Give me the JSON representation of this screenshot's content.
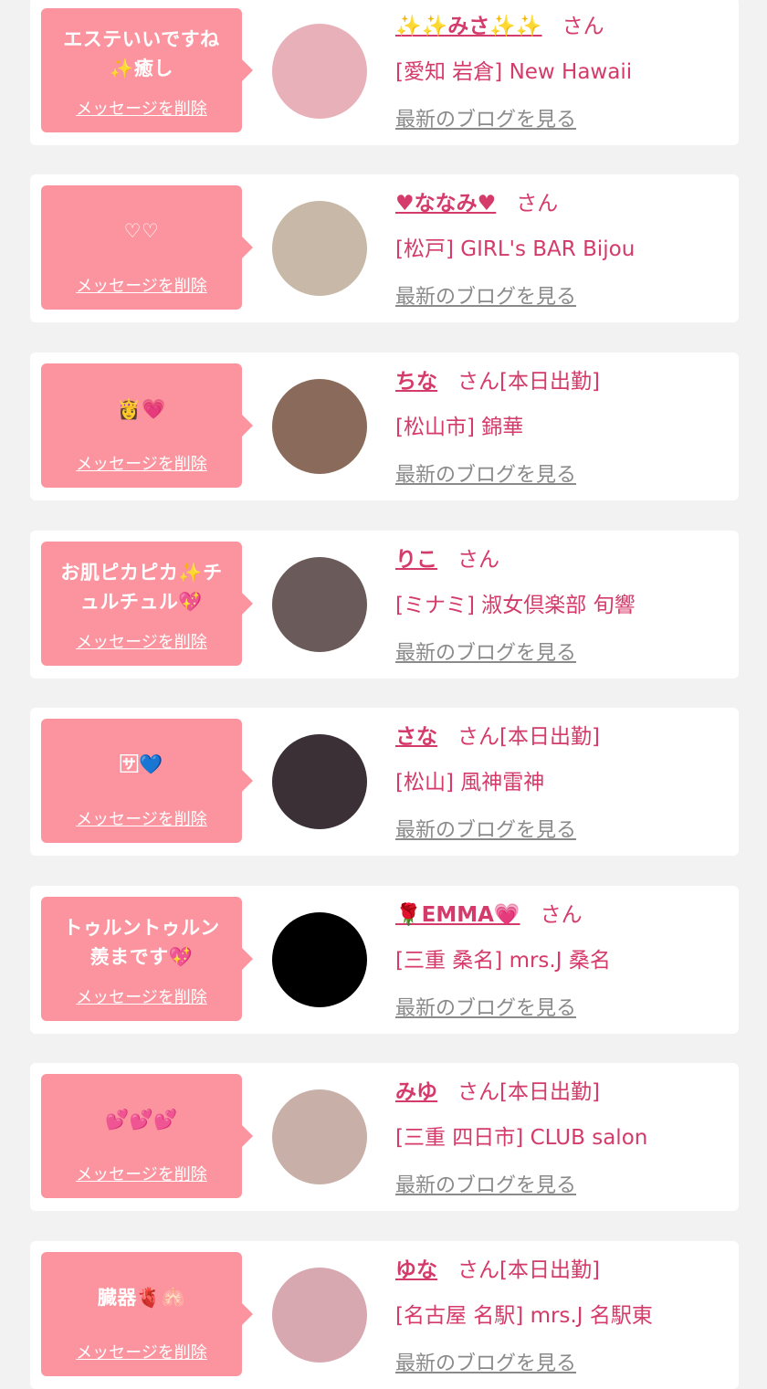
{
  "delete_label": "メッセージを削除",
  "blog_label": "最新のブログを見る",
  "san_label": "さん",
  "entries": [
    {
      "message": "エステいいですね\n✨癒し",
      "name": "✨✨みさ✨✨",
      "status": "",
      "shop": "[愛知 岩倉] New Hawaii",
      "avatar_color": "#e8b0b8"
    },
    {
      "message": "♡♡",
      "name": "♥ななみ♥",
      "status": "",
      "shop": "[松戸] GIRL's BAR Bijou",
      "avatar_color": "#c8b8a8"
    },
    {
      "message": "👸💗",
      "name": "ちな",
      "status": "[本日出勤]",
      "shop": "[松山市] 錦華",
      "avatar_color": "#8a6a5a"
    },
    {
      "message": "お肌ピカピカ✨チ\nュルチュル💖",
      "name": "りこ",
      "status": "",
      "shop": "[ミナミ] 淑女倶楽部 旬響",
      "avatar_color": "#6a5a5a"
    },
    {
      "message": "🈂💙",
      "name": "さな",
      "status": "[本日出勤]",
      "shop": "[松山] 風神雷神",
      "avatar_color": "#3a3035"
    },
    {
      "message": "トゥルントゥルン\n羨まです💖",
      "name": "🌹EMMA💗",
      "status": "",
      "shop": "[三重 桑名] mrs.J 桑名",
      "avatar_color": "#000000"
    },
    {
      "message": "💕💕💕",
      "name": "みゆ",
      "status": "[本日出勤]",
      "shop": "[三重 四日市] CLUB salon",
      "avatar_color": "#c8b0a8"
    },
    {
      "message": "臓器🫀🫁",
      "name": "ゆな",
      "status": "[本日出勤]",
      "shop": "[名古屋 名駅] mrs.J 名駅東",
      "avatar_color": "#d8a8b0"
    }
  ],
  "colors": {
    "bubble": "#fb949e",
    "accent": "#d43a6a",
    "muted": "#8a8a8a",
    "background": "#f2f2f2"
  }
}
